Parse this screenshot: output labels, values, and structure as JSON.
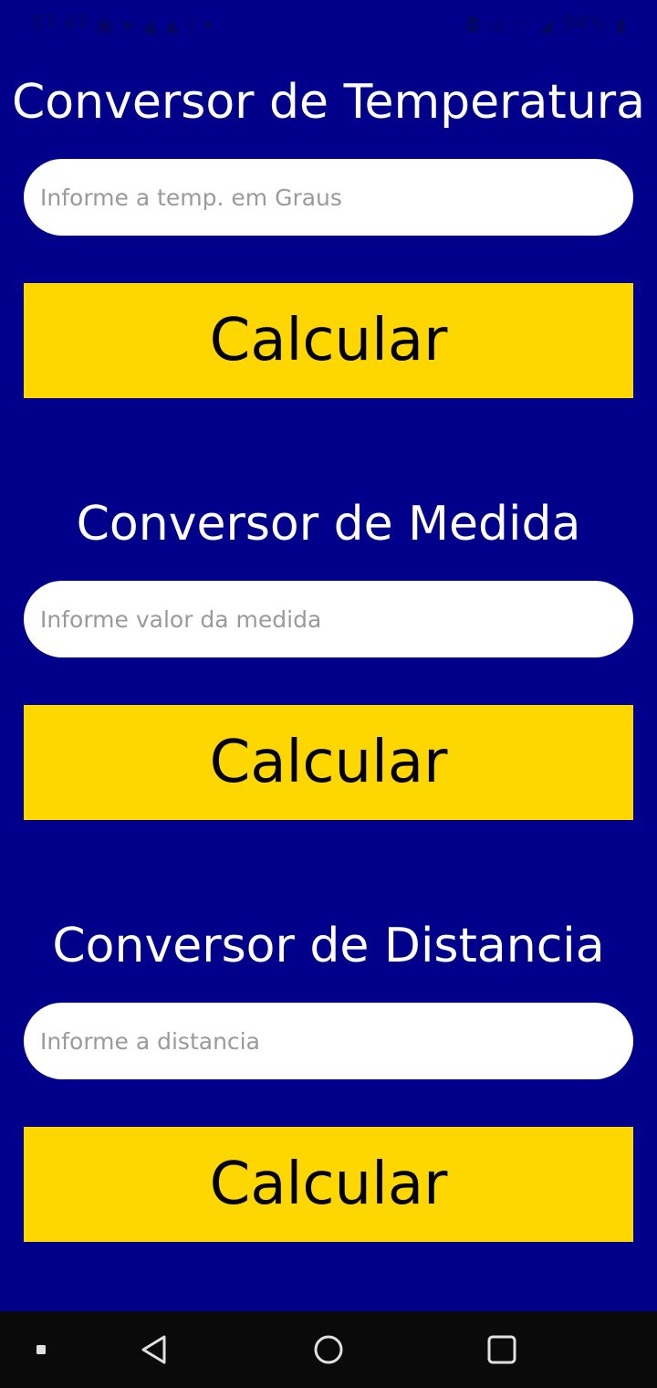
{
  "status_bar": {
    "time": "07:47",
    "battery": "94%",
    "left_icons": [
      "notification-icon",
      "telegram-icon",
      "warning-icon",
      "warning-icon",
      "sim-icon",
      "dropdown-icon"
    ],
    "right_icons": [
      "vibrate-icon",
      "alarm-icon",
      "wifi-icon",
      "signal-icon",
      "battery-icon"
    ]
  },
  "sections": [
    {
      "title": "Conversor de Temperatura",
      "input_placeholder": "Informe a temp. em Graus",
      "input_value": "",
      "button_label": "Calcular"
    },
    {
      "title": "Conversor de Medida",
      "input_placeholder": "Informe valor da medida",
      "input_value": "",
      "button_label": "Calcular"
    },
    {
      "title": "Conversor de Distancia",
      "input_placeholder": "Informe a distancia",
      "input_value": "",
      "button_label": "Calcular"
    }
  ],
  "nav_bar": {
    "items": [
      "recent-dot-icon",
      "back-icon",
      "home-icon",
      "overview-icon"
    ]
  },
  "colors": {
    "background": "#00008b",
    "button": "#ffd700",
    "title_text": "#ffffff",
    "nav_bar": "#0a0a0a"
  }
}
